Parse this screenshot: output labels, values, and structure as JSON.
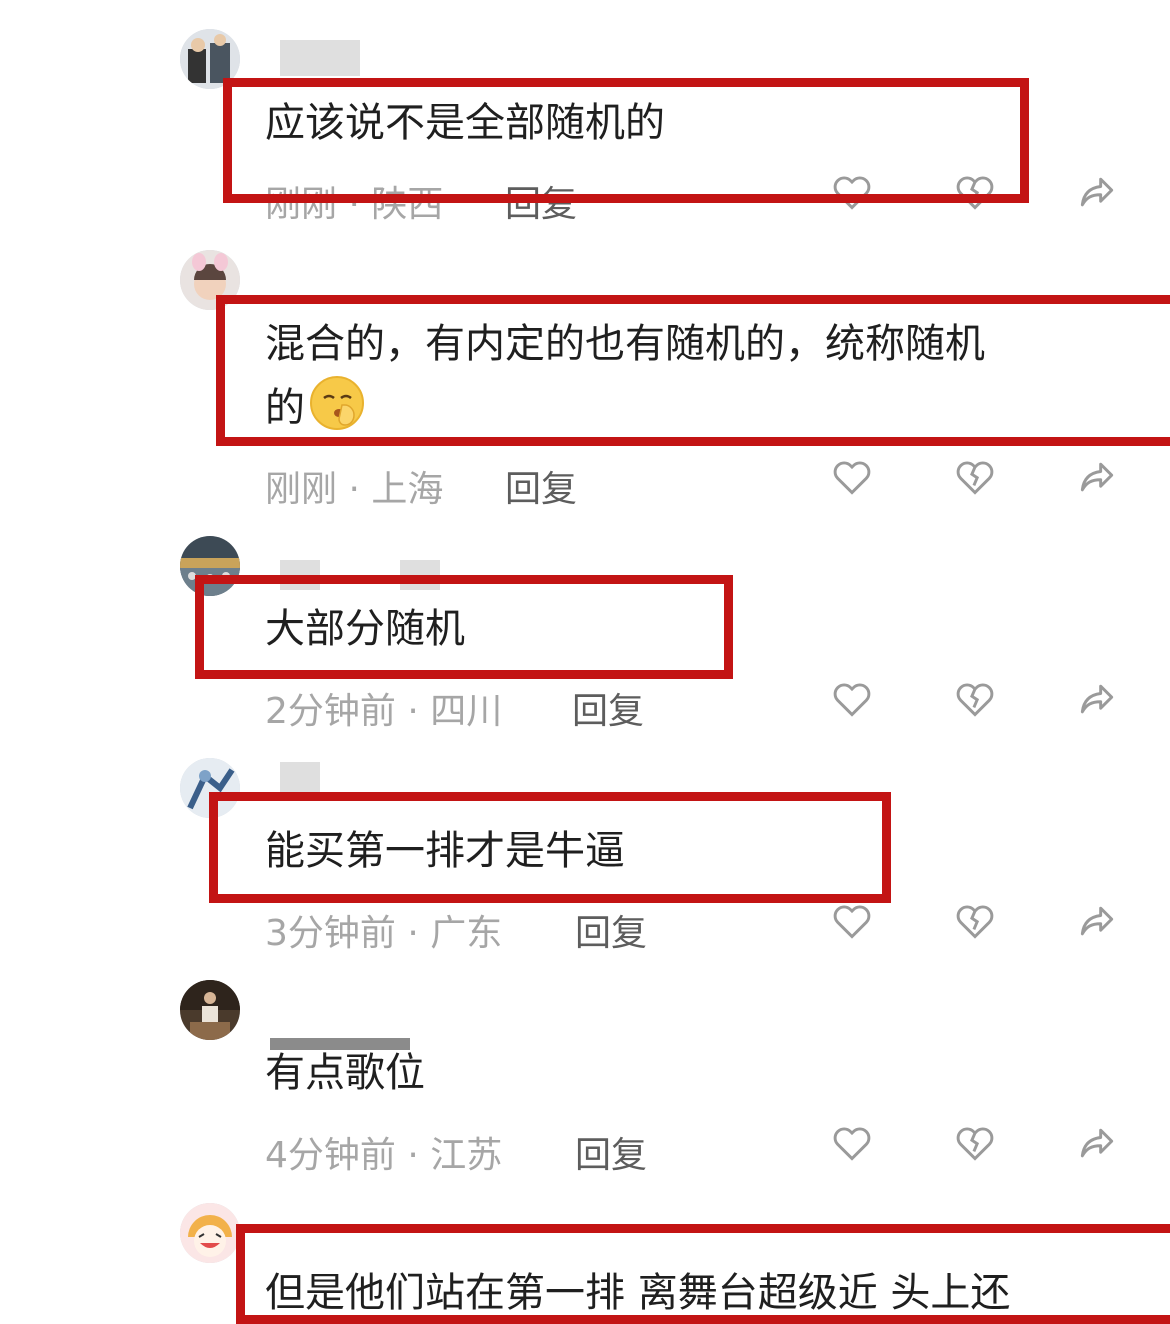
{
  "comments": [
    {
      "text": "应该说不是全部随机的",
      "time": "刚刚",
      "location": "陕西",
      "reply": "回复"
    },
    {
      "text": "混合的，有内定的也有随机的，统称随机",
      "text2": "的",
      "emoji": "shushing-face-emoji",
      "time": "刚刚",
      "location": "上海",
      "reply": "回复"
    },
    {
      "text": "大部分随机",
      "time": "2分钟前",
      "location": "四川",
      "reply": "回复"
    },
    {
      "text": "能买第一排才是牛逼",
      "time": "3分钟前",
      "location": "广东",
      "reply": "回复"
    },
    {
      "text": "有点歌位",
      "time": "4分钟前",
      "location": "江苏",
      "reply": "回复"
    },
    {
      "text": "但是他们站在第一排 离舞台超级近 头上还"
    }
  ],
  "separator": " · ",
  "icons": {
    "like": "heart-outline-icon",
    "dislike": "broken-heart-icon",
    "share": "share-arrow-icon"
  },
  "colors": {
    "highlight_box": "#c31414",
    "meta_text": "#a6a6a6",
    "reply_text": "#5d5d5d"
  }
}
